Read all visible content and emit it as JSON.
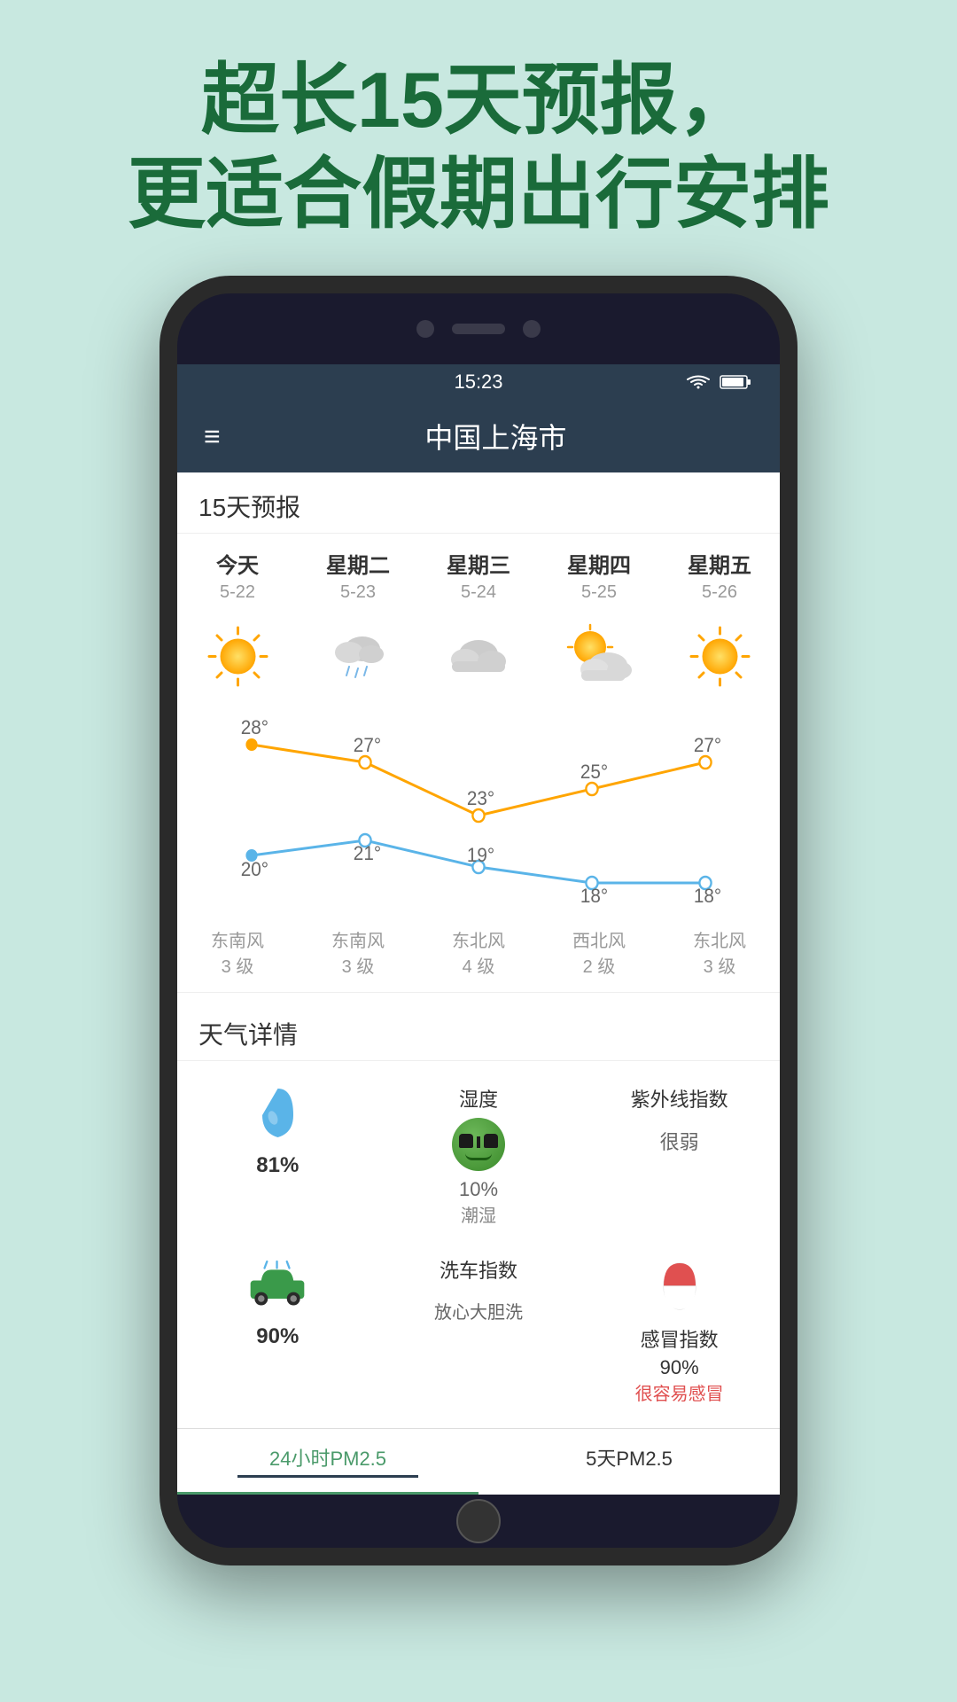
{
  "header": {
    "line1": "超长15天预报，",
    "line2": "更适合假期出行安排"
  },
  "statusBar": {
    "time": "15:23",
    "wifi": "wifi",
    "battery": "battery"
  },
  "appHeader": {
    "menu": "≡",
    "title": "中国上海市"
  },
  "forecast": {
    "sectionTitle": "15天预报",
    "days": [
      {
        "name": "今天",
        "date": "5-22",
        "weather": "sunny",
        "high": "28°",
        "low": "20°",
        "windDir": "东南风",
        "windLevel": "3 级"
      },
      {
        "name": "星期二",
        "date": "5-23",
        "weather": "rainy",
        "high": "27°",
        "low": "21°",
        "windDir": "东南风",
        "windLevel": "3 级"
      },
      {
        "name": "星期三",
        "date": "5-24",
        "weather": "cloudy",
        "high": "23°",
        "low": "19°",
        "windDir": "东北风",
        "windLevel": "4 级"
      },
      {
        "name": "星期四",
        "date": "5-25",
        "weather": "partly-cloudy",
        "high": "25°",
        "low": "18°",
        "windDir": "西北风",
        "windLevel": "2 级"
      },
      {
        "name": "星期五",
        "date": "5-26",
        "weather": "sunny",
        "high": "27°",
        "low": "18°",
        "windDir": "东北风",
        "windLevel": "3 级"
      }
    ]
  },
  "details": {
    "sectionTitle": "天气详情",
    "items": [
      {
        "icon": "droplet",
        "label": "",
        "value": "81%",
        "sublabel": ""
      },
      {
        "icon": "emoji-cool",
        "label": "湿度",
        "value": "10%",
        "sublabel": "潮湿"
      },
      {
        "icon": "uv",
        "label": "紫外线指数",
        "value": "",
        "sublabel": "很弱"
      },
      {
        "icon": "car-wash",
        "label": "",
        "value": "90%",
        "sublabel": ""
      },
      {
        "icon": "wash",
        "label": "洗车指数",
        "value": "",
        "sublabel": "放心大胆洗"
      },
      {
        "icon": "pill",
        "label": "感冒指数",
        "value": "90%",
        "sublabel": "很容易感冒"
      }
    ]
  },
  "bottomTabs": [
    {
      "label": "24小时PM2.5",
      "active": true
    },
    {
      "label": "5天PM2.5",
      "active": false
    }
  ]
}
